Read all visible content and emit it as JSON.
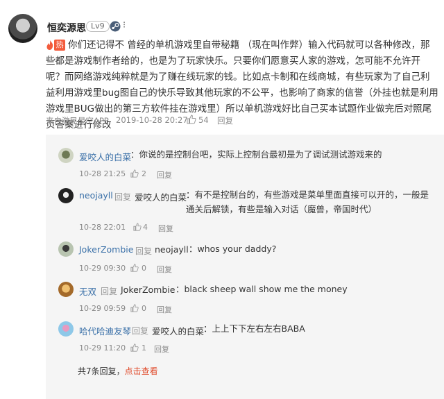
{
  "comment": {
    "username": "恒奕源思",
    "level": "Lv9",
    "menu_glyph": "⁝",
    "hot_label": "热",
    "text": "你们还记得不 曾经的单机游戏里自带秘籍 （现在叫作弊）输入代码就可以各种修改，那些都是游戏制作者给的，也是为了玩家快乐。只要你们愿意买人家的游戏，怎可能不允许开呢？而网络游戏纯粹就是为了赚在线玩家的钱。比如点卡制和在线商城，有些玩家为了自己利益利用游戏里bug图自己的快乐导致其他玩家的不公平，也影响了商家的信誉（外挂也就是利用游戏里BUG做出的第三方软件挂在游戏里）所以单机游戏好比自己买本试题作业做完后对照尾页答案进行修改",
    "source": "来自游民星空APP",
    "timestamp": "2019-10-28 20:27",
    "likes": "54",
    "reply_label": "回复"
  },
  "replies": [
    {
      "name": "爱咬人的白菜",
      "tag": "",
      "target": "",
      "text": "：你说的是控制台吧，实际上控制台最初是为了调试测试游戏来的",
      "time": "10-28 21:25",
      "likes": "2",
      "reply_label": "回复"
    },
    {
      "name": "neojayll",
      "tag": "回复",
      "target": "爱咬人的白菜",
      "text": "：有不是控制台的，有些游戏是菜单里面直接可以开的，一般是通关后解锁，有些是输入对话（魔兽，帝国时代）",
      "time": "10-28 22:01",
      "likes": "4",
      "reply_label": "回复"
    },
    {
      "name": "JokerZombie",
      "tag": "回复",
      "target": "neojayll",
      "text": "：whos your daddy?",
      "time": "10-29 09:30",
      "likes": "0",
      "reply_label": "回复"
    },
    {
      "name": "无双",
      "tag": "回复",
      "target": "JokerZombie",
      "text": "：black sheep wall show me the money",
      "time": "10-29 09:59",
      "likes": "0",
      "reply_label": "回复"
    },
    {
      "name": "哈代哈迪友琴",
      "tag": "回复",
      "target": "爱咬人的白菜",
      "text": "：上上下下左右左右BABA",
      "time": "10-29 11:20",
      "likes": "1",
      "reply_label": "回复"
    }
  ],
  "summary": {
    "count_text": "共7条回复，",
    "link_text": "点击查看"
  },
  "colors": {
    "link": "#3a70a8",
    "hot": "#f35b3c",
    "summary_link": "#e04a2a",
    "reply_bg": "#f5f5f5"
  }
}
